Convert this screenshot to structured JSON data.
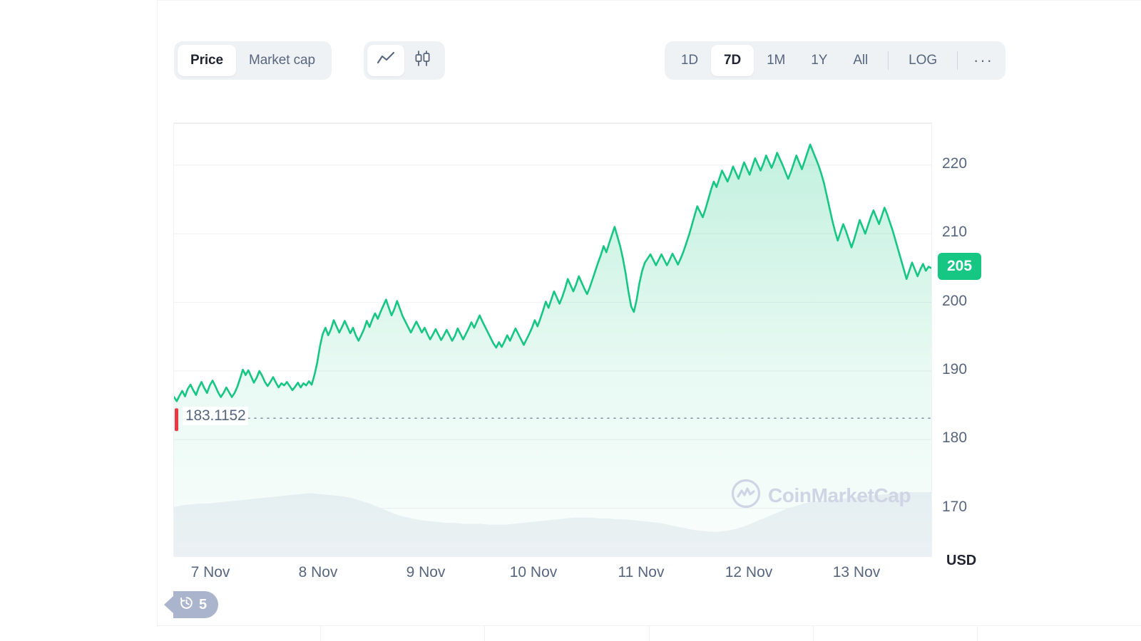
{
  "toolbar": {
    "metric_tabs": [
      {
        "id": "price",
        "label": "Price",
        "active": true
      },
      {
        "id": "market-cap",
        "label": "Market cap",
        "active": false
      }
    ],
    "chart_type_tabs": [
      {
        "id": "line",
        "icon": "line-chart-icon",
        "active": true
      },
      {
        "id": "candles",
        "icon": "candlestick-icon",
        "active": false
      }
    ],
    "range_tabs": [
      {
        "id": "1D",
        "label": "1D",
        "active": false
      },
      {
        "id": "7D",
        "label": "7D",
        "active": true
      },
      {
        "id": "1M",
        "label": "1M",
        "active": false
      },
      {
        "id": "1Y",
        "label": "1Y",
        "active": false
      },
      {
        "id": "All",
        "label": "All",
        "active": false
      }
    ],
    "log_label": "LOG",
    "more_label": "···"
  },
  "chart": {
    "currency_label": "USD",
    "annotation_label": "183.1152",
    "annotation_value": 183.1152,
    "current_price_label": "205",
    "current_price_value": 205,
    "watermark_text": "CoinMarketCap",
    "history_badge": {
      "icon": "history-clock-icon",
      "count": "5"
    },
    "colors": {
      "line": "#16c784",
      "area_top": "#16c784",
      "badge": "#16c784",
      "marker_red": "#ea3943",
      "grid": "#f2f3f6",
      "axis_text": "#58667e",
      "volume": "#eff1f6",
      "watermark": "#cfd5e4",
      "history_badge": "#aab4cc"
    }
  },
  "chart_data": {
    "type": "area",
    "title": "",
    "subtitle": "",
    "xlabel": "",
    "ylabel": "USD",
    "grid": true,
    "legend": "none",
    "currency": "USD",
    "range": "7D",
    "ylim": [
      163,
      226
    ],
    "yticks": [
      220,
      210,
      200,
      190,
      180,
      170
    ],
    "xticks": [
      "7 Nov",
      "8 Nov",
      "9 Nov",
      "10 Nov",
      "11 Nov",
      "12 Nov",
      "13 Nov"
    ],
    "annotations": [
      {
        "type": "hline",
        "value": 183.1152,
        "label": "183.1152",
        "style": "dotted"
      },
      {
        "type": "current-price-badge",
        "value": 205,
        "label": "205"
      }
    ],
    "series": [
      {
        "name": "Price",
        "unit": "USD",
        "values": [
          186.2,
          185.6,
          186.4,
          187.1,
          186.3,
          187.4,
          188.0,
          187.2,
          186.5,
          187.6,
          188.4,
          187.5,
          186.8,
          187.9,
          188.6,
          187.8,
          186.9,
          186.2,
          186.8,
          187.6,
          186.9,
          186.2,
          186.8,
          187.7,
          188.9,
          190.2,
          189.4,
          190.1,
          189.2,
          188.3,
          189.0,
          190.0,
          189.3,
          188.4,
          187.8,
          188.4,
          189.1,
          188.3,
          187.6,
          188.2,
          187.9,
          188.4,
          187.8,
          187.2,
          187.7,
          188.3,
          187.6,
          188.2,
          187.9,
          188.5,
          188.0,
          189.4,
          191.2,
          193.6,
          195.4,
          196.3,
          195.2,
          196.1,
          197.4,
          196.5,
          195.6,
          196.4,
          197.3,
          196.4,
          195.5,
          196.3,
          195.2,
          194.4,
          195.2,
          196.1,
          197.3,
          196.4,
          197.5,
          198.4,
          197.6,
          198.6,
          199.5,
          200.4,
          199.2,
          198.1,
          199.0,
          200.2,
          199.1,
          198.0,
          197.2,
          196.4,
          195.6,
          196.4,
          197.2,
          196.4,
          195.6,
          196.3,
          195.4,
          194.6,
          195.3,
          196.1,
          195.3,
          194.5,
          195.2,
          196.0,
          195.2,
          194.4,
          195.1,
          196.2,
          195.4,
          194.6,
          195.4,
          196.2,
          197.1,
          196.3,
          197.2,
          198.1,
          197.2,
          196.4,
          195.6,
          194.8,
          194.0,
          193.4,
          194.2,
          193.5,
          194.3,
          195.2,
          194.4,
          195.3,
          196.2,
          195.4,
          194.6,
          193.8,
          194.6,
          195.4,
          196.3,
          197.4,
          196.5,
          197.6,
          198.8,
          200.1,
          199.2,
          200.4,
          201.6,
          200.7,
          199.8,
          200.8,
          202.0,
          203.4,
          202.5,
          201.6,
          202.6,
          203.8,
          202.9,
          202.0,
          201.2,
          202.2,
          203.4,
          204.6,
          205.8,
          206.9,
          208.2,
          207.3,
          208.6,
          209.8,
          211.0,
          209.6,
          208.2,
          206.4,
          204.2,
          201.6,
          199.4,
          198.6,
          200.4,
          202.8,
          204.6,
          205.8,
          206.4,
          207.0,
          206.2,
          205.4,
          206.2,
          207.0,
          206.2,
          205.4,
          206.2,
          207.1,
          206.3,
          205.5,
          206.4,
          207.4,
          208.6,
          209.8,
          211.2,
          212.6,
          214.0,
          213.2,
          212.4,
          213.6,
          215.0,
          216.4,
          217.6,
          216.8,
          218.0,
          219.2,
          218.4,
          217.6,
          218.6,
          219.8,
          218.9,
          218.0,
          219.2,
          220.4,
          219.5,
          218.6,
          219.8,
          221.0,
          220.1,
          219.2,
          220.2,
          221.4,
          220.5,
          219.6,
          220.6,
          221.8,
          220.9,
          220.0,
          219.0,
          218.0,
          219.0,
          220.2,
          221.4,
          220.4,
          219.4,
          220.6,
          221.8,
          223.0,
          222.0,
          221.0,
          220.0,
          218.8,
          217.4,
          215.6,
          213.8,
          212.0,
          210.4,
          209.0,
          210.2,
          211.4,
          210.4,
          209.2,
          208.0,
          209.2,
          210.6,
          212.0,
          211.0,
          210.0,
          211.2,
          212.4,
          213.4,
          212.4,
          211.4,
          212.6,
          213.8,
          212.8,
          211.6,
          210.4,
          209.0,
          207.6,
          206.2,
          204.8,
          203.4,
          204.6,
          205.8,
          204.8,
          203.8,
          204.8,
          205.6,
          204.6,
          205.2,
          205.0
        ]
      }
    ],
    "volume": {
      "name": "Volume",
      "values": [
        0.56,
        0.58,
        0.59,
        0.6,
        0.6,
        0.61,
        0.62,
        0.63,
        0.64,
        0.65,
        0.66,
        0.67,
        0.68,
        0.69,
        0.7,
        0.71,
        0.72,
        0.71,
        0.7,
        0.69,
        0.68,
        0.66,
        0.63,
        0.6,
        0.56,
        0.52,
        0.48,
        0.45,
        0.43,
        0.41,
        0.4,
        0.39,
        0.38,
        0.38,
        0.37,
        0.37,
        0.37,
        0.36,
        0.36,
        0.36,
        0.37,
        0.38,
        0.39,
        0.4,
        0.41,
        0.42,
        0.43,
        0.44,
        0.44,
        0.44,
        0.43,
        0.43,
        0.42,
        0.42,
        0.41,
        0.4,
        0.39,
        0.38,
        0.36,
        0.34,
        0.32,
        0.3,
        0.29,
        0.28,
        0.28,
        0.29,
        0.31,
        0.34,
        0.38,
        0.42,
        0.46,
        0.5,
        0.54,
        0.57,
        0.6,
        0.62,
        0.63,
        0.64,
        0.65,
        0.66,
        0.67,
        0.68,
        0.69,
        0.7,
        0.71,
        0.72,
        0.73,
        0.73,
        0.73,
        0.73
      ]
    }
  }
}
